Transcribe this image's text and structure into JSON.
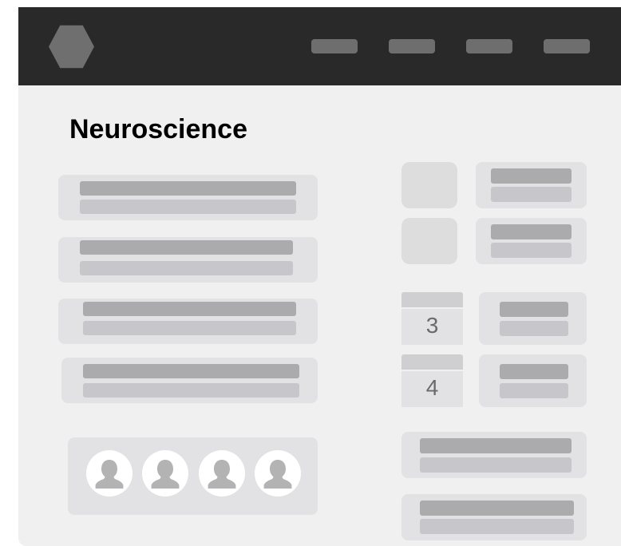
{
  "page": {
    "title": "Neuroscience"
  },
  "calendar": [
    {
      "day": "3"
    },
    {
      "day": "4"
    }
  ],
  "icons": {
    "logo": "hexagon-logo-icon",
    "avatar": "user-silhouette-icon"
  },
  "colors": {
    "header_bg": "#292929",
    "panel_bg": "#f0f0f0",
    "card_bg": "#e2e2e5",
    "bar_dark": "#ababae",
    "bar_light": "#c7c7cb"
  }
}
